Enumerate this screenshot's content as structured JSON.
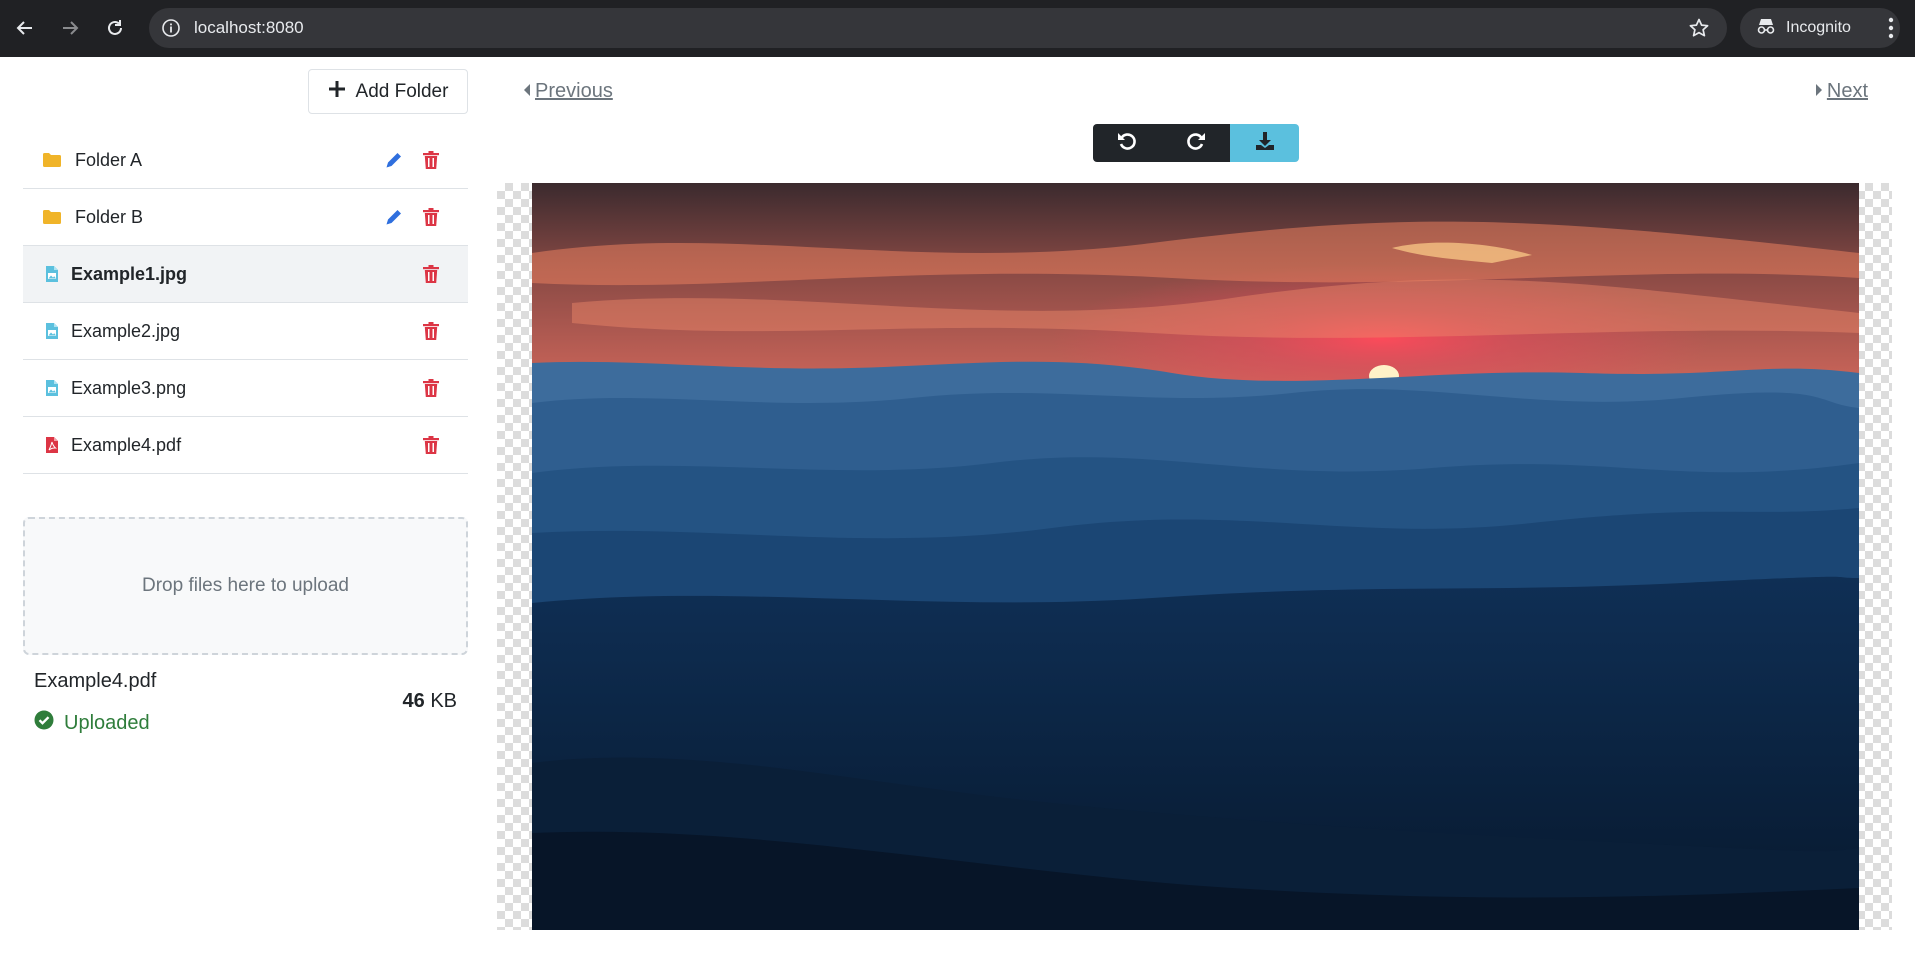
{
  "browser": {
    "url": "localhost:8080",
    "profile_label": "Incognito",
    "icons": [
      "back-arrow-icon",
      "forward-arrow-icon",
      "reload-icon",
      "info-icon",
      "star-icon",
      "incognito-icon",
      "more-vert-icon"
    ]
  },
  "sidebar": {
    "add_folder_label": "Add Folder",
    "items": [
      {
        "type": "folder",
        "name": "Folder A",
        "icon": "folder-icon",
        "editable": true
      },
      {
        "type": "folder",
        "name": "Folder B",
        "icon": "folder-icon",
        "editable": true
      },
      {
        "type": "image",
        "name": "Example1.jpg",
        "icon": "file-image-icon",
        "selected": true
      },
      {
        "type": "image",
        "name": "Example2.jpg",
        "icon": "file-image-icon"
      },
      {
        "type": "image",
        "name": "Example3.png",
        "icon": "file-image-icon"
      },
      {
        "type": "pdf",
        "name": "Example4.pdf",
        "icon": "file-pdf-icon"
      }
    ],
    "dropzone_text": "Drop files here to upload",
    "upload": {
      "file_name": "Example4.pdf",
      "status": "Uploaded",
      "size_value": "46",
      "size_unit": "KB"
    }
  },
  "viewer": {
    "previous_label": "Previous",
    "next_label": "Next",
    "toolbar": [
      "rotate-left-icon",
      "rotate-right-icon",
      "download-icon"
    ]
  },
  "colors": {
    "folder": "#f0b429",
    "edit": "#2f6fde",
    "delete": "#dc3545",
    "file_image": "#5bc0de",
    "file_pdf": "#dc3545",
    "uploaded": "#2f7d3b",
    "download_button": "#5bc0de",
    "toolbar_dark": "#212529"
  }
}
